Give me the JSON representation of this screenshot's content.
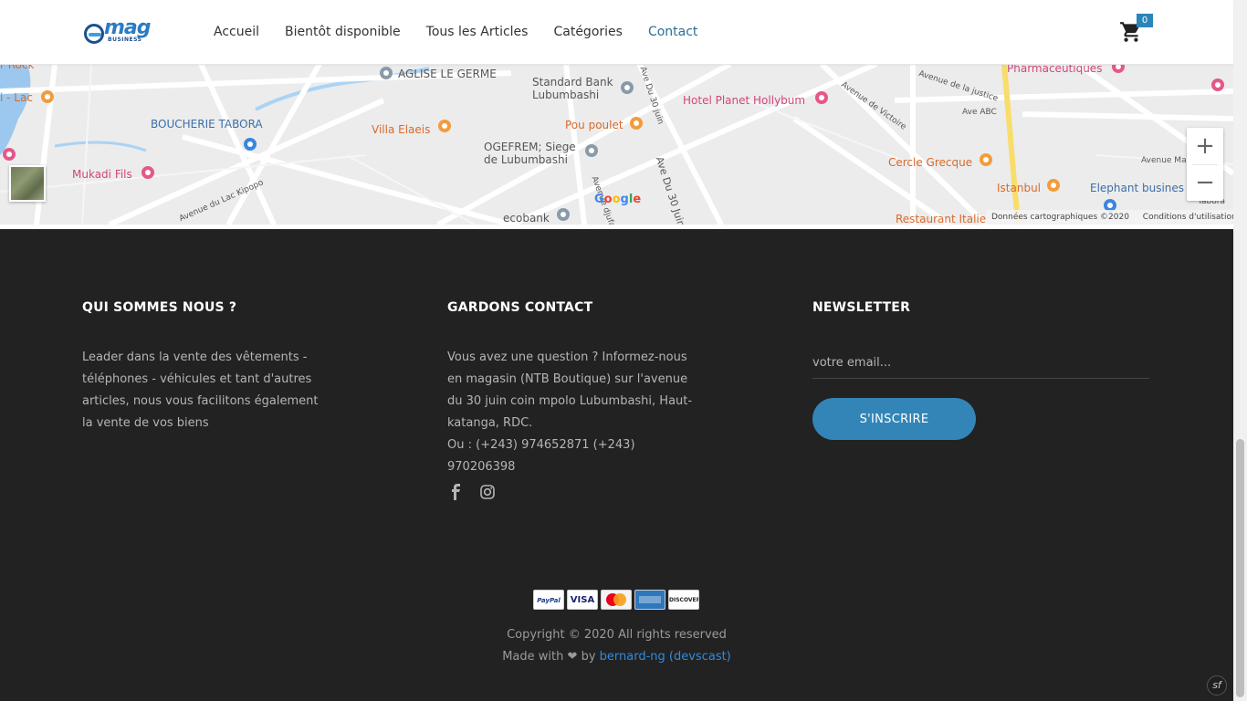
{
  "header": {
    "logo_text": "mag",
    "logo_subtext": "BUSINESS",
    "nav": [
      {
        "label": "Accueil"
      },
      {
        "label": "Bientôt disponible"
      },
      {
        "label": "Tous les Articles"
      },
      {
        "label": "Catégories"
      },
      {
        "label": "Contact"
      }
    ],
    "active_nav": "Contact",
    "cart_count": "0",
    "accent_color": "#2a6f97"
  },
  "map": {
    "labels": {
      "aglise": "AGLISE LE GERME",
      "standard_bank": "Standard Bank\nLubumbashi",
      "boucherie": "BOUCHERIE TABORA",
      "villa": "Villa Elaeis",
      "pou_poulet": "Pou poulet",
      "hotel": "Hotel Planet Hollybum",
      "ogefrem": "OGEFREM; Siege\nde Lubumbashi",
      "mukadi": "Mukadi Fils",
      "ecobank": "ecobank",
      "cercle": "Cercle Grecque",
      "istanbul": "Istanbul",
      "elephant": "Elephant busines",
      "restaurant": "Restaurant Italie",
      "pharma": "Pharmaceutiques",
      "ave_30_juin": "Ave Du 30 Juin",
      "ave_30_juin_small": "Ave Du 30 juin",
      "ave_victoire": "Avenue de Victoire",
      "ave_justice": "Avenue de la justice",
      "ave_abc": "Ave ABC",
      "ave_lac": "Avenue du Lac Kipopo",
      "ave_mo": "Avenue Ma",
      "lac": "i - Lac",
      "rock": "r Rock",
      "avenue_djufa": "Avenue djufa",
      "tabora": "Tabora"
    },
    "google": [
      "G",
      "o",
      "o",
      "g",
      "l",
      "e"
    ],
    "attribution": "Données cartographiques ©2020",
    "terms": "Conditions d'utilisation",
    "zoom_in": "+",
    "zoom_out": "−"
  },
  "footer": {
    "about": {
      "title": "QUI SOMMES NOUS ?",
      "text": "Leader dans la vente des vêtements - téléphones - véhicules et tant d'autres articles, nous vous facilitons également la vente de vos biens"
    },
    "contact": {
      "title": "GARDONS CONTACT",
      "text": "Vous avez une question ? Informez-nous en magasin (NTB Boutique) sur l'avenue du 30 juin coin mpolo Lubumbashi, Haut-katanga, RDC.",
      "phones": "Ou : (+243) 974652871   (+243) 970206398",
      "social": [
        "facebook-icon",
        "instagram-icon"
      ]
    },
    "newsletter": {
      "title": "NEWSLETTER",
      "placeholder": "votre email...",
      "button": "S'INSCRIRE"
    },
    "payments": [
      "PayPal",
      "VISA",
      "MasterCard",
      "AMERICAN EXPRESS",
      "DISCOVER"
    ],
    "copyright": "Copyright © 2020 All rights reserved",
    "made_with_prefix": "Made with",
    "made_with_by": "by",
    "author": "bernard-ng (devscast)"
  }
}
